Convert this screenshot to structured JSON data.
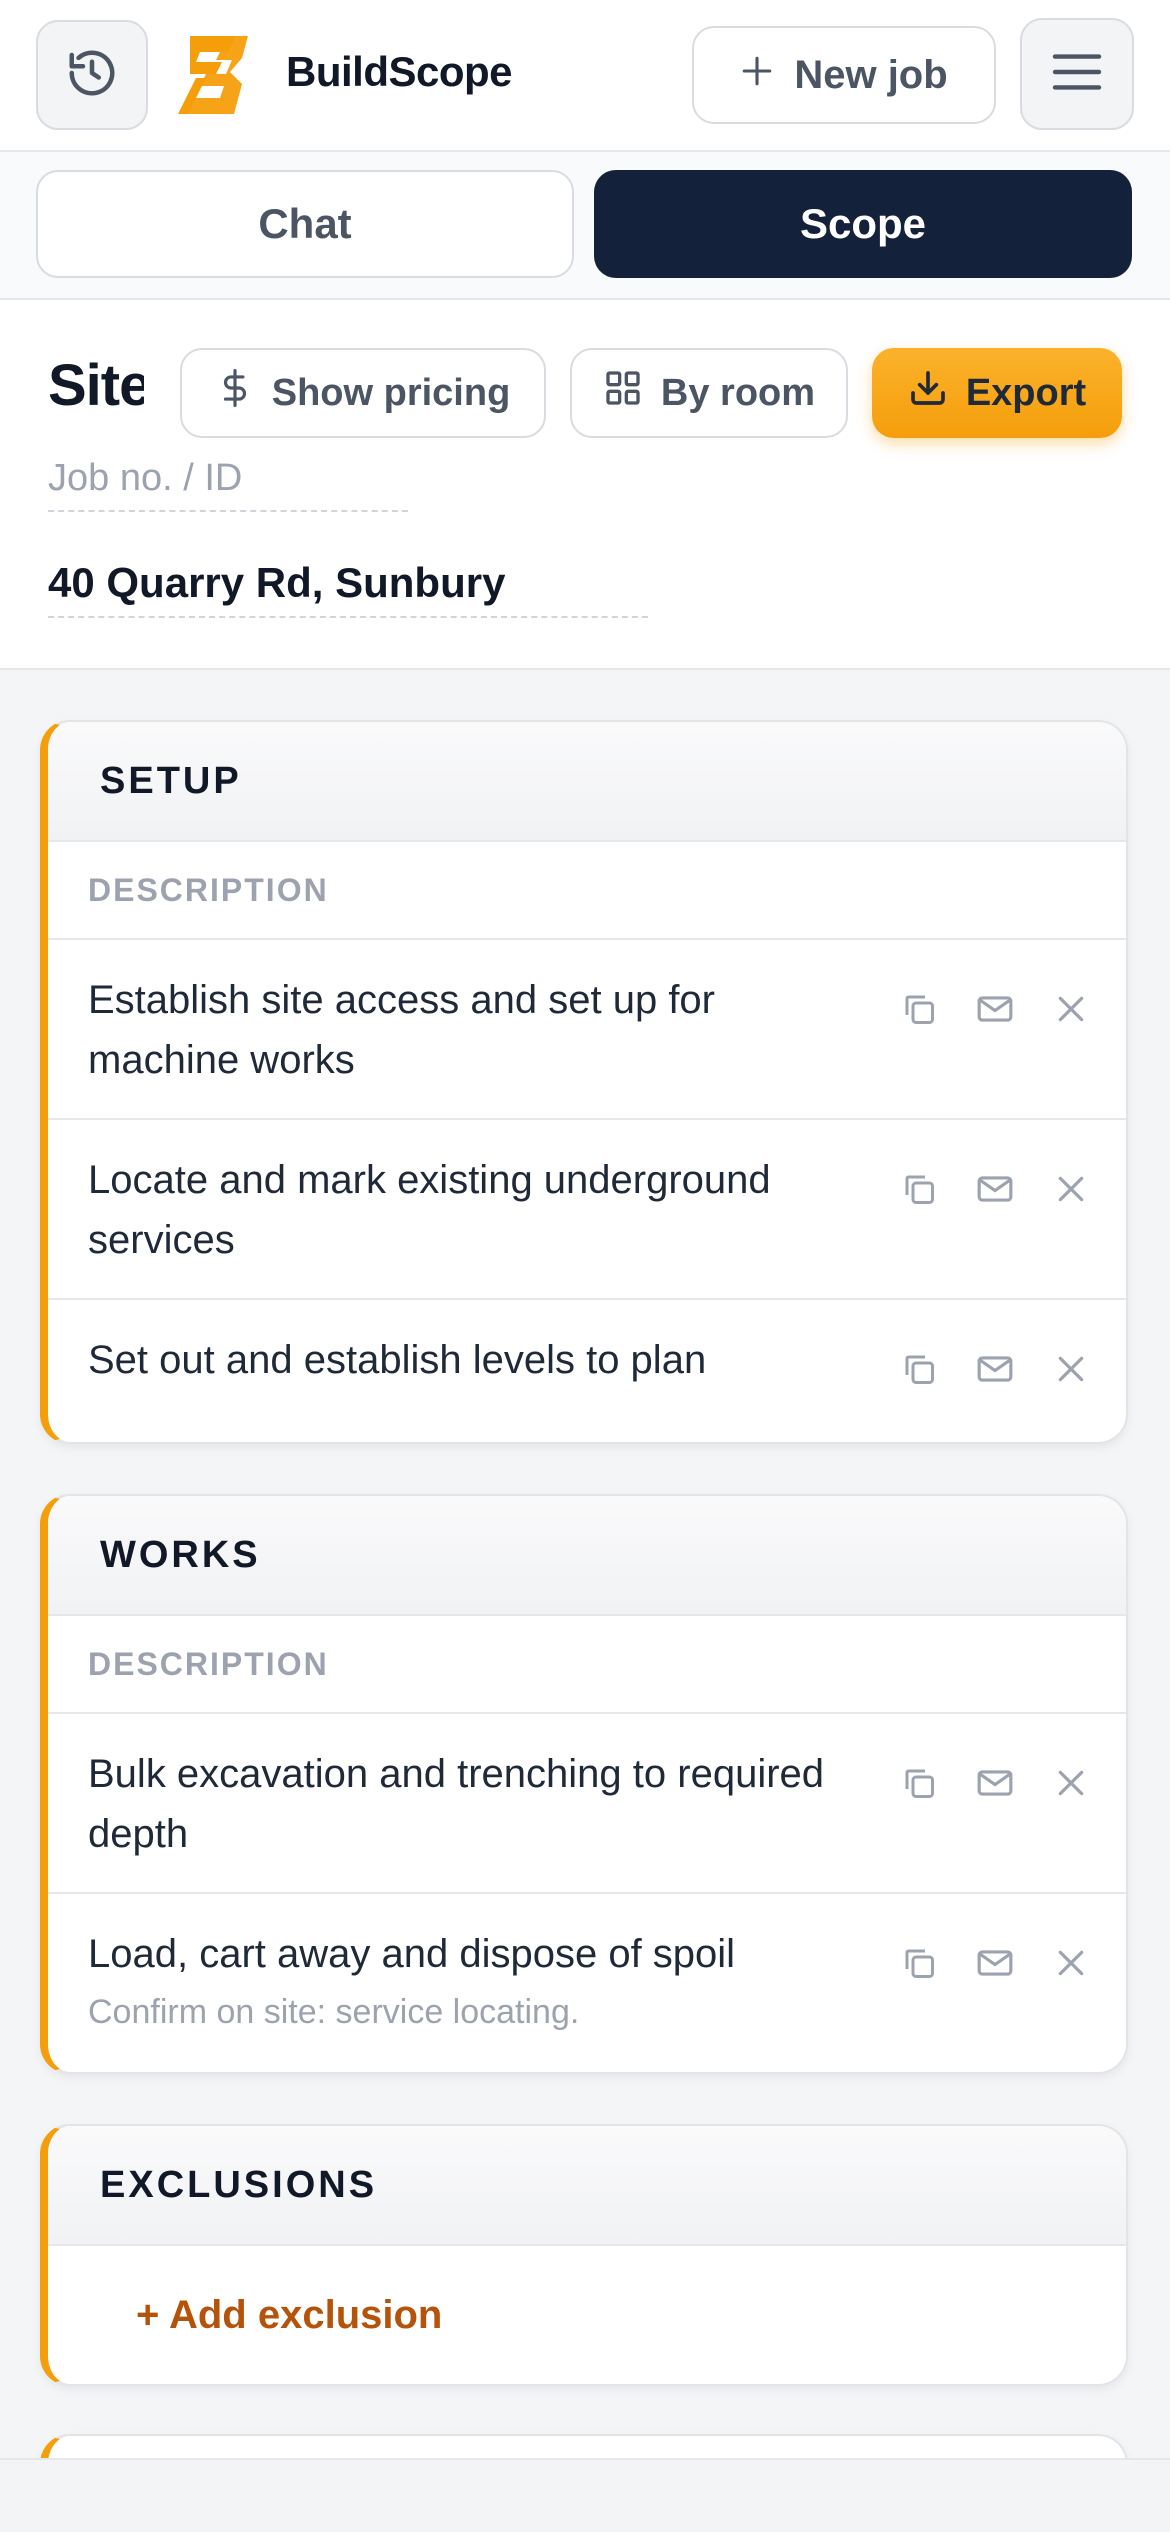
{
  "header": {
    "brand": "BuildScope",
    "new_job_label": "New job",
    "icons": {
      "history": "history-icon",
      "plus": "plus-icon",
      "menu": "menu-icon",
      "logo": "buildscope-logo"
    },
    "brand_color": "#f59e0b"
  },
  "tabs": [
    {
      "label": "Chat",
      "active": false
    },
    {
      "label": "Scope",
      "active": true
    }
  ],
  "job": {
    "title": "Site",
    "job_id_placeholder": "Job no. / ID",
    "address": "40 Quarry Rd, Sunbury",
    "show_pricing_label": "Show pricing",
    "by_room_label": "By room",
    "export_label": "Export"
  },
  "sections": [
    {
      "title": "SETUP",
      "column": "DESCRIPTION",
      "items": [
        {
          "text": "Establish site access and set up for machine works",
          "note": ""
        },
        {
          "text": "Locate and mark existing underground services",
          "note": ""
        },
        {
          "text": "Set out and establish levels to plan",
          "note": ""
        }
      ]
    },
    {
      "title": "WORKS",
      "column": "DESCRIPTION",
      "items": [
        {
          "text": "Bulk excavation and trenching to required depth",
          "note": ""
        },
        {
          "text": "Load, cart away and dispose of spoil",
          "note": "Confirm on site: service locating."
        }
      ]
    },
    {
      "title": "EXCLUSIONS",
      "add_label": "+ Add exclusion"
    }
  ],
  "colors": {
    "accent": "#f59e0b",
    "dark": "#14213a",
    "add_link": "#b45309"
  }
}
